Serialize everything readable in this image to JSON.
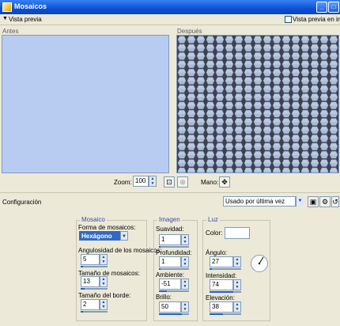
{
  "window": {
    "title": "Mosaicos"
  },
  "preview": {
    "toggle_label": "Vista previa",
    "in_image_label": "Vista previa en imagen"
  },
  "panels": {
    "before_label": "Antes",
    "after_label": "Después"
  },
  "zoom": {
    "label": "Zoom:",
    "value": "100"
  },
  "hand": {
    "label": "Mano:"
  },
  "config": {
    "label": "Configuración",
    "preset": "Usado por última vez"
  },
  "mosaic": {
    "title": "Mosaico",
    "shape_label": "Forma de mosaicos:",
    "shape_value": "Hexágono",
    "angularity_label": "Angulosidad de los mosaicos:",
    "angularity_value": "5",
    "size_label": "Tamaño de mosaicos:",
    "size_value": "13",
    "border_label": "Tamaño del borde:",
    "border_value": "2"
  },
  "image": {
    "title": "Imagen",
    "smoothness_label": "Suavidad:",
    "smoothness_value": "1",
    "depth_label": "Profundidad:",
    "depth_value": "1",
    "ambient_label": "Ambiente:",
    "ambient_value": "-51",
    "brightness_label": "Brillo:",
    "brightness_value": "50"
  },
  "light": {
    "title": "Luz",
    "color_label": "Color:",
    "angle_label": "Ángulo:",
    "angle_value": "27",
    "intensity_label": "Intensidad:",
    "intensity_value": "74",
    "elevation_label": "Elevación:",
    "elevation_value": "38"
  }
}
